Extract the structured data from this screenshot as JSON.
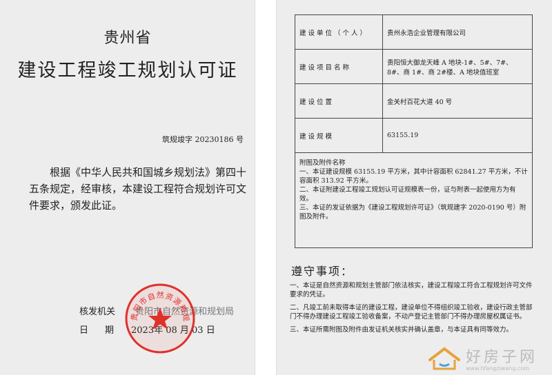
{
  "left": {
    "province": "贵州省",
    "title": "建设工程竣工规划认可证",
    "cert_no": "筑规竣字 20230186 号",
    "body": "根据《中华人民共和国城乡规划法》第四十五条规定，经审核，本建设工程符合规划许可文件要求，颁发此证。",
    "issuer_label": "核发机关",
    "issuer_name": "贵阳市自然资源和规划局",
    "date_label": "日期",
    "date_value": "2023年 08 月 03 日",
    "seal": {
      "ring_text": "贵阳市自然资源和规划局",
      "color": "#e0302a"
    }
  },
  "right": {
    "rows": [
      {
        "label": "建设单位（个人）",
        "value": "贵州永浩企业管理有限公司"
      },
      {
        "label": "建设项目名称",
        "value": "贵阳恒大御龙天峰 A 地块-1#、5#、7#、8#、商 1#、商 2#楼、A 地块值班室"
      },
      {
        "label": "建设位置",
        "value": "金关村百花大道 40 号"
      },
      {
        "label": "建设规模",
        "value": "63155.19"
      }
    ],
    "notes_title": "附图及附件名称",
    "notes": [
      "一、本证建设规模 63155.19 平方米，其中计容面积 62841.27 平方米，不计容面积 313.92 平方米。",
      "二、本证附建设工程竣工规划认可证规模表一份，证与附表一起使用方为有效。",
      "三、本证的发证依据为《建设工程规划许可证》（筑规建字 2020-0190 号）附图及附件。"
    ],
    "observe_title": "遵守事项：",
    "observe": [
      "一、本证是自然资源和规划主管部门依法核实，建设工程竣工符合工程规划许可文件要求的凭证。",
      "二、凡竣工前未取得本证的建设工程，建设单位不得组织竣工验收，建设行政主管部门不得办理建设工程竣工验收备案，不动产登记主管部门不得办理房屋权属证书。",
      "三、本证所需附图及附件由发证机关核实并确认盖章，与本证具有同等效力。"
    ]
  },
  "watermark": {
    "text": "好房子网",
    "url": "www.hfangziwang.com",
    "color": "#bbbbbb"
  }
}
